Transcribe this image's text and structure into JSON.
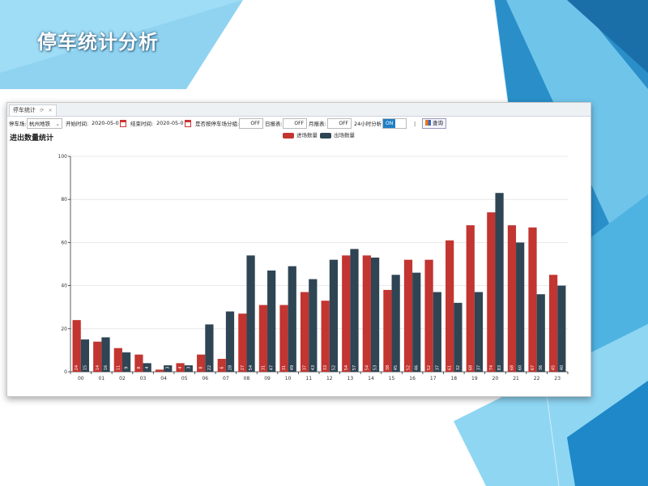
{
  "slide": {
    "title": "停车统计分析"
  },
  "tab": {
    "label": "停车统计",
    "icons": [
      "refresh-icon",
      "close-icon"
    ]
  },
  "toolbar": {
    "lot_label": "停车场:",
    "lot_value": "杭州地铁",
    "start_label": "开始时间:",
    "start_value": "2020-05-01",
    "end_label": "结束时间:",
    "end_value": "2020-05-08",
    "group_label": "是否按停车场分组:",
    "group_state": "OFF",
    "daily_label": "日报表:",
    "daily_state": "OFF",
    "monthly_label": "月报表:",
    "monthly_state": "OFF",
    "hourly_label": "24小时分析:",
    "hourly_state": "ON",
    "separator": "|",
    "query_label": "查询"
  },
  "colors": {
    "in": "#c23531",
    "out": "#2f4554",
    "accent": "#1e7fc6"
  },
  "chart_data": {
    "type": "bar",
    "title": "进出数量统计",
    "categories": [
      "00",
      "01",
      "02",
      "03",
      "04",
      "05",
      "06",
      "07",
      "08",
      "09",
      "10",
      "11",
      "12",
      "13",
      "14",
      "15",
      "16",
      "17",
      "18",
      "19",
      "20",
      "21",
      "22",
      "23"
    ],
    "series": [
      {
        "name": "进场数量",
        "values": [
          24,
          14,
          11,
          8,
          1,
          4,
          8,
          6,
          27,
          31,
          31,
          37,
          33,
          54,
          54,
          38,
          52,
          52,
          61,
          68,
          74,
          68,
          67,
          45
        ]
      },
      {
        "name": "出场数量",
        "values": [
          15,
          16,
          9,
          4,
          3,
          3,
          22,
          28,
          54,
          47,
          49,
          43,
          52,
          57,
          53,
          45,
          46,
          37,
          32,
          37,
          83,
          60,
          36,
          40
        ]
      }
    ],
    "ylim": [
      0,
      100
    ],
    "yticks": [
      0,
      20,
      40,
      60,
      80,
      100
    ],
    "grid": true,
    "legend": "top-right",
    "data_labels": "inside-bottom"
  }
}
